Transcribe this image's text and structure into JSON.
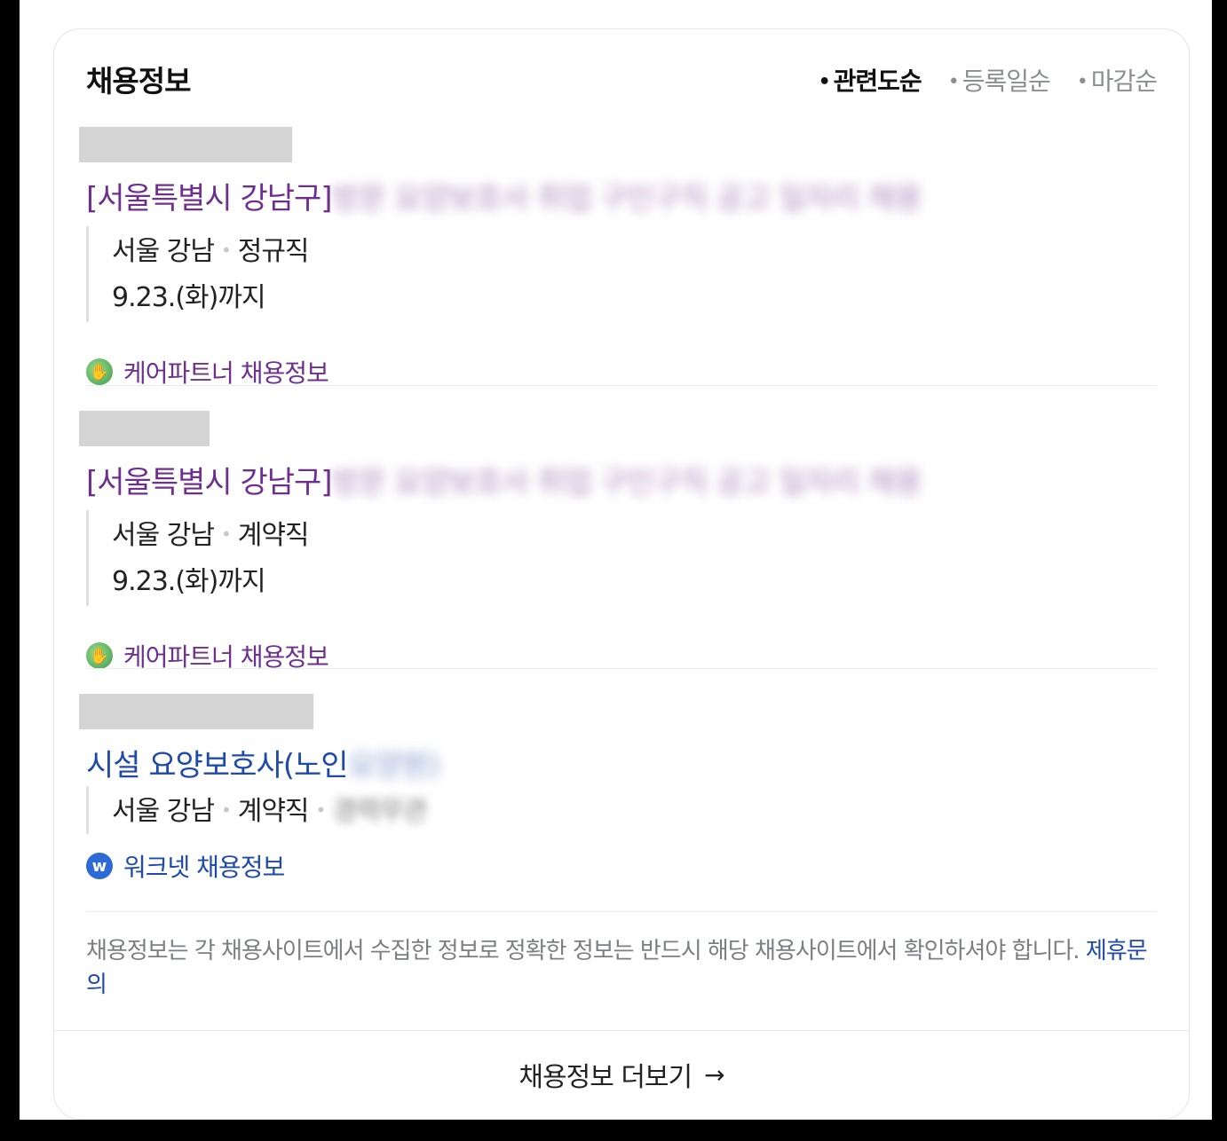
{
  "panel": {
    "title": "채용정보",
    "sort_options": [
      {
        "label": "관련도순",
        "active": true
      },
      {
        "label": "등록일순",
        "active": false
      },
      {
        "label": "마감순",
        "active": false
      }
    ]
  },
  "jobs": [
    {
      "title_visible": "[서울특별시 강남구]",
      "title_blurred": "방문 요양보호사 취업 구인구직 공고 일자리 채용",
      "location": "서울 강남",
      "employment_type": "정규직",
      "deadline": "9.23.(화)까지",
      "source": "케어파트너 채용정보",
      "source_icon": "handshake-icon"
    },
    {
      "title_visible": "[서울특별시 강남구]",
      "title_blurred": "방문 요양보호사 취업 구인구직 공고 일자리 채용",
      "location": "서울 강남",
      "employment_type": "계약직",
      "deadline": "9.23.(화)까지",
      "source": "케어파트너 채용정보",
      "source_icon": "handshake-icon"
    },
    {
      "title_visible": "시설 요양보호사(노인",
      "title_blurred": "요양원)",
      "location": "서울 강남",
      "employment_type": "계약직",
      "extra_blurred": "경력무관",
      "source": "워크넷 채용정보",
      "source_icon": "worknet-icon"
    }
  ],
  "notice": {
    "text": "채용정보는 각 채용사이트에서 수집한 정보로 정확한 정보는 반드시 해당 채용사이트에서 확인하셔야 합니다.",
    "link": "제휴문의"
  },
  "more": {
    "label": "채용정보 더보기",
    "arrow": "→"
  },
  "colors": {
    "title_purple": "#6e2f8f",
    "link_blue": "#1f4aa8",
    "mask_gray": "#d4d4d4"
  }
}
